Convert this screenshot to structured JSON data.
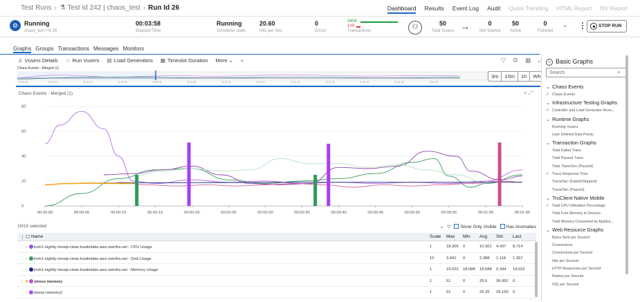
{
  "breadcrumb": {
    "test_runs": "Test Runs",
    "test": "Test Id 242 | chaos_test",
    "run": "Run Id 26"
  },
  "nav_tabs": [
    {
      "label": "Dashboard",
      "state": "active"
    },
    {
      "label": "Results",
      "state": "normal"
    },
    {
      "label": "Event Log",
      "state": "normal"
    },
    {
      "label": "Audit",
      "state": "normal"
    },
    {
      "label": "Quick Trending",
      "state": "disabled"
    },
    {
      "label": "HTML Report",
      "state": "disabled"
    },
    {
      "label": "NV Report",
      "state": "disabled"
    }
  ],
  "status": {
    "state": "Running",
    "state_sub": "chaos_test | Id 26",
    "elapsed": "00:03:58",
    "elapsed_label": "Elapsed Time",
    "scheduler": "Running",
    "scheduler_label": "Scheduler state",
    "hits": "20.60",
    "hits_label": "Hits per Sec.",
    "errors": "0",
    "errors_label": "Errors",
    "trans_pass": "2404",
    "trans_fail": "100",
    "trans_label": "Transactions",
    "total_vusers": "50",
    "total_vusers_label": "Total Vusers",
    "not_started": "0",
    "not_started_label": "Not Started",
    "active": "50",
    "active_label": "Active",
    "finished": "0",
    "finished_label": "Finished",
    "stop_label": "STOP RUN",
    "colors": {
      "pass": "#1d9a3b",
      "fail": "#dd3333"
    }
  },
  "view_tabs": [
    {
      "label": "Graphs",
      "active": true
    },
    {
      "label": "Groups"
    },
    {
      "label": "Transactions"
    },
    {
      "label": "Messages"
    },
    {
      "label": "Monitors"
    }
  ],
  "toolbar": [
    "Vusers Details",
    "Run Vusers",
    "Load Generators",
    "Timeslot Duration",
    "More"
  ],
  "zoom": [
    "3m",
    "10m",
    "1h",
    "Whole"
  ],
  "mini_label": "Chaos Events - Merged (1)",
  "chart_title": "Chaos Events - Merged (1)",
  "selection": {
    "count": "10/10 selected",
    "show_only_visible": "Show Only Visible",
    "has_anomalies": "Has Anomalies"
  },
  "table": {
    "headers": [
      "Name",
      "Scale",
      "Max",
      "Min",
      "Avg",
      "Std",
      "Last"
    ],
    "rows": [
      {
        "name": "lnxh1-nightly-mssql-clean.lnadmlabs.aws.swinfra.net - CPU Usage",
        "color": "#a24de0",
        "scale": "1",
        "max": "18.305",
        "min": "0",
        "avg": "10.301",
        "std": "4.437",
        "last": "8.714",
        "star": false,
        "bold": false
      },
      {
        "name": "lnxh1-nightly-mssql-clean.lnadmlabs.aws.swinfra.net - Disk Usage",
        "color": "#2f9a57",
        "scale": "10",
        "max": "3.841",
        "min": "0",
        "avg": "2.288",
        "std": "1.118",
        "last": "1.357",
        "star": false,
        "bold": false
      },
      {
        "name": "lnxh1-nightly-mssql-clean.lnadmlabs.aws.swinfra.net - Memory Usage",
        "color": "#1a2a8c",
        "scale": "1",
        "max": "19.022",
        "min": "18.088",
        "avg": "18.588",
        "std": "0.344",
        "last": "19.022",
        "star": false,
        "bold": false
      },
      {
        "name": "stress memory",
        "color": "#c451d2",
        "scale": "1",
        "max": "51",
        "min": "0",
        "avg": "25.5",
        "std": "36.062",
        "last": "0",
        "star": true,
        "bold": true
      },
      {
        "name": "stress memory2",
        "color": "#b34fe0",
        "scale": "1",
        "max": "51",
        "min": "0",
        "avg": "25.25",
        "std": "29.159",
        "last": "0",
        "star": false,
        "bold": false
      }
    ]
  },
  "right_panel": {
    "title": "Basic Graphs",
    "search_placeholder": "Search",
    "groups": [
      {
        "title": "Chaos Events",
        "items": [
          {
            "label": "Chaos Events",
            "checked": true
          }
        ]
      },
      {
        "title": "Infrastructure Testing Graphs",
        "items": [
          {
            "label": "Controller and Load Generator Reso...",
            "checked": true
          }
        ]
      },
      {
        "title": "Runtime Graphs",
        "items": [
          {
            "label": "Running Vusers"
          },
          {
            "label": "User Defined Data Points"
          }
        ]
      },
      {
        "title": "Transaction Graphs",
        "items": [
          {
            "label": "Total Failed Trans"
          },
          {
            "label": "Total Passed Trans"
          },
          {
            "label": "Total Trans/Sec (Passed)"
          },
          {
            "label": "Trans Response Time",
            "checked": true
          },
          {
            "label": "Trans/Sec (Failed/Stopped)"
          },
          {
            "label": "Trans/Sec (Passed)"
          }
        ]
      },
      {
        "title": "TruClient Native Mobile",
        "items": [
          {
            "label": "Total CPU Utilization Percentage",
            "checked": true
          },
          {
            "label": "Total Free Memory in Devices"
          },
          {
            "label": "Total Memory Consumed by Applica..."
          }
        ]
      },
      {
        "title": "Web Resource Graphs",
        "items": [
          {
            "label": "Bytes Sent per Second"
          },
          {
            "label": "Connections"
          },
          {
            "label": "Connections per Second"
          },
          {
            "label": "Hits per Second"
          },
          {
            "label": "HTTP Responses per Second"
          },
          {
            "label": "Retries per Second"
          },
          {
            "label": "SSL per Second"
          }
        ]
      }
    ]
  },
  "chart_data": {
    "type": "line",
    "title": "Chaos Events - Merged (1)",
    "x_ticks": [
      "00:00:00",
      "00:00:05",
      "00:00:10",
      "00:00:15",
      "00:00:20",
      "00:00:25",
      "00:00:30",
      "00:00:35",
      "00:00:40",
      "00:00:45",
      "00:00:50",
      "00:00:55",
      "00:01:00",
      "00:01:05"
    ],
    "x_range_seconds": [
      0,
      65
    ],
    "ylim": [
      0,
      80
    ],
    "y_ticks": [
      0,
      20,
      40,
      60,
      80
    ],
    "grid": true,
    "series": [
      {
        "color": "#b86be6",
        "points": [
          [
            0,
            50
          ],
          [
            2,
            65
          ],
          [
            5,
            76
          ],
          [
            8,
            62
          ],
          [
            10,
            40
          ],
          [
            12,
            20
          ],
          [
            15,
            18
          ],
          [
            20,
            21
          ],
          [
            25,
            19
          ],
          [
            30,
            20
          ],
          [
            35,
            18
          ],
          [
            40,
            19
          ],
          [
            45,
            18
          ],
          [
            50,
            19
          ],
          [
            55,
            18
          ],
          [
            60,
            20
          ],
          [
            65,
            29
          ]
        ]
      },
      {
        "color": "#3a9a5c",
        "points": [
          [
            0,
            0
          ],
          [
            5,
            10
          ],
          [
            10,
            22
          ],
          [
            15,
            29
          ],
          [
            20,
            30
          ],
          [
            25,
            21
          ],
          [
            30,
            18
          ],
          [
            35,
            20
          ],
          [
            40,
            22
          ],
          [
            45,
            26
          ],
          [
            50,
            35
          ],
          [
            53,
            38
          ],
          [
            55,
            24
          ],
          [
            58,
            15
          ],
          [
            60,
            18
          ],
          [
            65,
            25
          ]
        ]
      },
      {
        "color": "#8e44ad",
        "points": [
          [
            8,
            25
          ],
          [
            12,
            26
          ],
          [
            16,
            29
          ],
          [
            20,
            32
          ],
          [
            24,
            25
          ],
          [
            28,
            18
          ],
          [
            32,
            17
          ],
          [
            36,
            18
          ],
          [
            40,
            31
          ],
          [
            44,
            30
          ],
          [
            48,
            32
          ],
          [
            52,
            44
          ],
          [
            56,
            40
          ],
          [
            58,
            28
          ],
          [
            62,
            21
          ],
          [
            65,
            24
          ]
        ]
      },
      {
        "color": "#b7e0c2",
        "points": [
          [
            12,
            24
          ],
          [
            16,
            28
          ],
          [
            20,
            30
          ],
          [
            24,
            28
          ],
          [
            28,
            29
          ],
          [
            32,
            38
          ],
          [
            36,
            34
          ],
          [
            40,
            34
          ],
          [
            44,
            31
          ],
          [
            48,
            33
          ],
          [
            52,
            29
          ],
          [
            56,
            25
          ],
          [
            60,
            19
          ],
          [
            64,
            20
          ]
        ]
      },
      {
        "color": "#d35f9e",
        "points": [
          [
            10,
            19
          ],
          [
            14,
            17
          ],
          [
            18,
            16
          ],
          [
            22,
            17
          ],
          [
            26,
            16
          ],
          [
            30,
            17
          ],
          [
            34,
            18
          ],
          [
            38,
            17
          ],
          [
            42,
            15
          ],
          [
            46,
            17
          ],
          [
            50,
            16
          ],
          [
            54,
            17
          ],
          [
            58,
            18
          ],
          [
            62,
            20
          ],
          [
            65,
            19
          ]
        ]
      },
      {
        "color": "#1a2a8c",
        "points": [
          [
            5,
            18.4
          ],
          [
            10,
            18.5
          ],
          [
            15,
            18.6
          ],
          [
            20,
            18.7
          ],
          [
            25,
            18.8
          ],
          [
            30,
            18.9
          ],
          [
            35,
            19
          ],
          [
            40,
            19
          ],
          [
            45,
            19
          ],
          [
            50,
            19
          ],
          [
            55,
            19
          ],
          [
            60,
            19
          ],
          [
            65,
            19
          ]
        ]
      },
      {
        "color": "#f2a516",
        "points": [
          [
            0,
            17
          ],
          [
            3,
            18
          ],
          [
            6,
            18.3
          ],
          [
            9,
            18.1
          ],
          [
            12,
            18
          ]
        ]
      }
    ],
    "event_bars": [
      {
        "x": 12.5,
        "value": 25,
        "color": "#2f9a57"
      },
      {
        "x": 19.6,
        "value": 51,
        "color": "#a93ef0"
      },
      {
        "x": 36.8,
        "value": 25,
        "color": "#2f9a57"
      },
      {
        "x": 38.6,
        "value": 50,
        "color": "#a93ef0"
      },
      {
        "x": 61.9,
        "value": 51,
        "color": "#c9508a"
      }
    ]
  }
}
